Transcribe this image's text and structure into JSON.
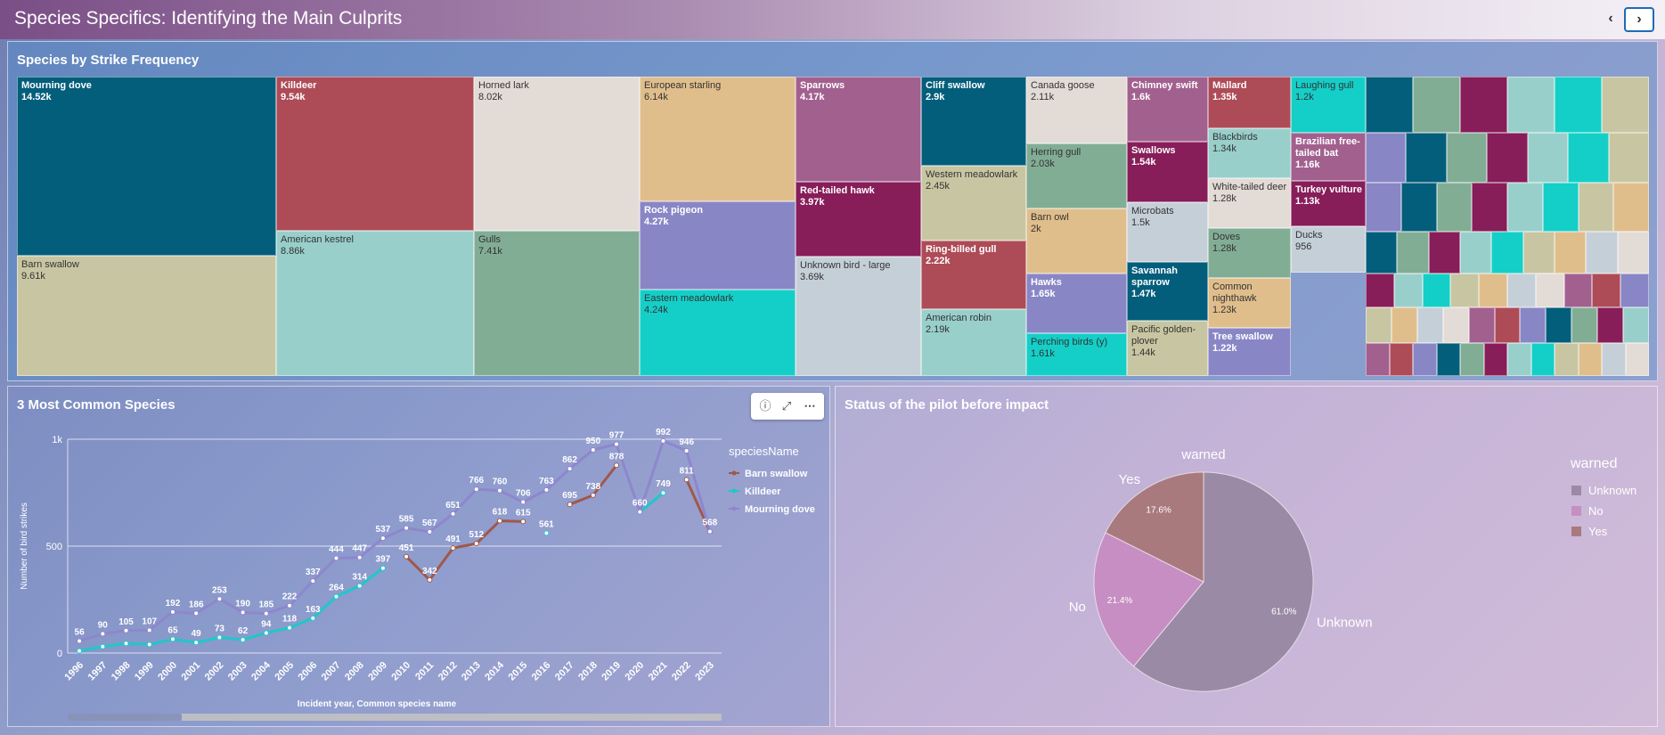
{
  "page": {
    "title": "Species Specifics: Identifying the Main Culprits",
    "prev_label": "‹",
    "next_label": "›"
  },
  "treemap": {
    "title": "Species by Strike Frequency",
    "tiles": [
      {
        "name": "Mourning dove",
        "value": "14.52k",
        "color": "#035e7b",
        "light": true
      },
      {
        "name": "Barn swallow",
        "value": "9.61k",
        "color": "#c8c6a2",
        "light": false
      },
      {
        "name": "Killdeer",
        "value": "9.54k",
        "color": "#ad4b57",
        "light": true
      },
      {
        "name": "American kestrel",
        "value": "8.86k",
        "color": "#99cfcb",
        "light": false
      },
      {
        "name": "Horned lark",
        "value": "8.02k",
        "color": "#e3dbd6",
        "light": false
      },
      {
        "name": "Gulls",
        "value": "7.41k",
        "color": "#82ad95",
        "light": false
      },
      {
        "name": "European starling",
        "value": "6.14k",
        "color": "#e0be8c",
        "light": false
      },
      {
        "name": "Rock pigeon",
        "value": "4.27k",
        "color": "#8986c6",
        "light": true
      },
      {
        "name": "Eastern meadowlark",
        "value": "4.24k",
        "color": "#14cfc8",
        "light": false
      },
      {
        "name": "Sparrows",
        "value": "4.17k",
        "color": "#a2608f",
        "light": true
      },
      {
        "name": "Red-tailed hawk",
        "value": "3.97k",
        "color": "#871d59",
        "light": true
      },
      {
        "name": "Unknown bird - large",
        "value": "3.69k",
        "color": "#c5cfd8",
        "light": false
      },
      {
        "name": "Cliff swallow",
        "value": "2.9k",
        "color": "#035e7b",
        "light": true
      },
      {
        "name": "Western meadowlark",
        "value": "2.45k",
        "color": "#c8c6a2",
        "light": false
      },
      {
        "name": "Ring-billed gull",
        "value": "2.22k",
        "color": "#ad4b57",
        "light": true
      },
      {
        "name": "American robin",
        "value": "2.19k",
        "color": "#99cfcb",
        "light": false
      },
      {
        "name": "Canada goose",
        "value": "2.11k",
        "color": "#e3dbd6",
        "light": false
      },
      {
        "name": "Herring gull",
        "value": "2.03k",
        "color": "#82ad95",
        "light": false
      },
      {
        "name": "Barn owl",
        "value": "2k",
        "color": "#e0be8c",
        "light": false
      },
      {
        "name": "Hawks",
        "value": "1.65k",
        "color": "#8986c6",
        "light": true
      },
      {
        "name": "Perching birds (y)",
        "value": "1.61k",
        "color": "#14cfc8",
        "light": false
      },
      {
        "name": "Chimney swift",
        "value": "1.6k",
        "color": "#a2608f",
        "light": true
      },
      {
        "name": "Swallows",
        "value": "1.54k",
        "color": "#871d59",
        "light": true
      },
      {
        "name": "Microbats",
        "value": "1.5k",
        "color": "#c5cfd8",
        "light": false
      },
      {
        "name": "Savannah sparrow",
        "value": "1.47k",
        "color": "#035e7b",
        "light": true
      },
      {
        "name": "Pacific golden-plover",
        "value": "1.44k",
        "color": "#c8c6a2",
        "light": false
      },
      {
        "name": "Mallard",
        "value": "1.35k",
        "color": "#ad4b57",
        "light": true
      },
      {
        "name": "Blackbirds",
        "value": "1.34k",
        "color": "#99cfcb",
        "light": false
      },
      {
        "name": "White-tailed deer",
        "value": "1.28k",
        "color": "#e3dbd6",
        "light": false
      },
      {
        "name": "Doves",
        "value": "1.28k",
        "color": "#82ad95",
        "light": false
      },
      {
        "name": "Common nighthawk",
        "value": "1.23k",
        "color": "#e0be8c",
        "light": false
      },
      {
        "name": "Tree swallow",
        "value": "1.22k",
        "color": "#8986c6",
        "light": true
      },
      {
        "name": "Laughing gull",
        "value": "1.2k",
        "color": "#14cfc8",
        "light": false
      },
      {
        "name": "Brazilian free-tailed bat",
        "value": "1.16k",
        "color": "#a2608f",
        "light": true
      },
      {
        "name": "Turkey vulture",
        "value": "1.13k",
        "color": "#871d59",
        "light": true
      },
      {
        "name": "Ducks",
        "value": "956",
        "color": "#c5cfd8",
        "light": false
      }
    ],
    "palette": [
      "#035e7b",
      "#c8c6a2",
      "#ad4b57",
      "#99cfcb",
      "#e3dbd6",
      "#82ad95",
      "#e0be8c",
      "#8986c6",
      "#14cfc8",
      "#a2608f",
      "#871d59",
      "#c5cfd8"
    ]
  },
  "line_chart": {
    "title": "3 Most Common Species",
    "info_icon": "info-icon",
    "expand_icon": "expand-icon",
    "more_icon": "more-icon"
  },
  "pie_chart": {
    "title": "Status of the pilot before impact"
  },
  "chart_data": [
    {
      "type": "line",
      "title": "3 Most Common Species",
      "xlabel": "Incident year, Common species name",
      "ylabel": "Number of bird strikes",
      "ylim": [
        0,
        1000
      ],
      "y_ticks": [
        "0",
        "500",
        "1k"
      ],
      "grid": true,
      "legend_title": "speciesName",
      "legend_position": "right",
      "x": [
        "1996",
        "1997",
        "1998",
        "1999",
        "2000",
        "2001",
        "2002",
        "2003",
        "2004",
        "2005",
        "2006",
        "2007",
        "2008",
        "2009",
        "2010",
        "2011",
        "2012",
        "2013",
        "2014",
        "2015",
        "2016",
        "2017",
        "2018",
        "2019",
        "2020",
        "2021",
        "2022",
        "2023"
      ],
      "series": [
        {
          "name": "Barn swallow",
          "color": "#a0584a",
          "values": [
            null,
            null,
            null,
            null,
            null,
            null,
            null,
            null,
            null,
            null,
            null,
            null,
            null,
            null,
            451,
            342,
            491,
            512,
            618,
            615,
            null,
            695,
            738,
            878,
            null,
            null,
            811,
            568
          ]
        },
        {
          "name": "Killdeer",
          "color": "#1fc8c8",
          "values": [
            10,
            30,
            45,
            40,
            65,
            49,
            73,
            62,
            94,
            118,
            163,
            264,
            314,
            397,
            null,
            null,
            null,
            null,
            null,
            null,
            561,
            null,
            null,
            null,
            660,
            749,
            null,
            null
          ]
        },
        {
          "name": "Mourning dove",
          "color": "#8f86cc",
          "values": [
            56,
            90,
            105,
            107,
            192,
            186,
            253,
            190,
            185,
            222,
            337,
            444,
            447,
            537,
            585,
            567,
            651,
            766,
            760,
            706,
            763,
            862,
            950,
            977,
            660,
            992,
            946,
            568
          ]
        }
      ],
      "value_labels": [
        {
          "i": 0,
          "v": 56
        },
        {
          "i": 1,
          "v": 90
        },
        {
          "i": 2,
          "v": 105
        },
        {
          "i": 3,
          "v": 107
        },
        {
          "i": 4,
          "v": 192
        },
        {
          "i": 4,
          "v": 65
        },
        {
          "i": 5,
          "v": 186
        },
        {
          "i": 5,
          "v": 49
        },
        {
          "i": 6,
          "v": 253
        },
        {
          "i": 6,
          "v": 73
        },
        {
          "i": 7,
          "v": 190
        },
        {
          "i": 7,
          "v": 62
        },
        {
          "i": 8,
          "v": 185
        },
        {
          "i": 8,
          "v": 94
        },
        {
          "i": 9,
          "v": 222
        },
        {
          "i": 9,
          "v": 118
        },
        {
          "i": 10,
          "v": 337
        },
        {
          "i": 10,
          "v": 163
        },
        {
          "i": 11,
          "v": 444
        },
        {
          "i": 11,
          "v": 264
        },
        {
          "i": 12,
          "v": 447
        },
        {
          "i": 12,
          "v": 314
        },
        {
          "i": 13,
          "v": 537
        },
        {
          "i": 13,
          "v": 397
        },
        {
          "i": 14,
          "v": 585
        },
        {
          "i": 14,
          "v": 451
        },
        {
          "i": 15,
          "v": 567
        },
        {
          "i": 15,
          "v": 342
        },
        {
          "i": 16,
          "v": 651
        },
        {
          "i": 16,
          "v": 491
        },
        {
          "i": 17,
          "v": 766
        },
        {
          "i": 17,
          "v": 512
        },
        {
          "i": 18,
          "v": 760
        },
        {
          "i": 18,
          "v": 618
        },
        {
          "i": 19,
          "v": 706
        },
        {
          "i": 19,
          "v": 615
        },
        {
          "i": 20,
          "v": 763
        },
        {
          "i": 20,
          "v": 561
        },
        {
          "i": 21,
          "v": 862
        },
        {
          "i": 21,
          "v": 695
        },
        {
          "i": 22,
          "v": 950
        },
        {
          "i": 22,
          "v": 738
        },
        {
          "i": 23,
          "v": 977
        },
        {
          "i": 23,
          "v": 878
        },
        {
          "i": 24,
          "v": 660
        },
        {
          "i": 25,
          "v": 992
        },
        {
          "i": 25,
          "v": 749
        },
        {
          "i": 26,
          "v": 946
        },
        {
          "i": 26,
          "v": 811
        },
        {
          "i": 27,
          "v": 568
        }
      ]
    },
    {
      "type": "pie",
      "title": "warned",
      "legend_title": "warned",
      "legend_position": "right",
      "slices": [
        {
          "label": "Unknown",
          "value": 61.0,
          "pct": "61.0%",
          "color": "#9b8aa6"
        },
        {
          "label": "No",
          "value": 21.4,
          "pct": "21.4%",
          "color": "#c68ec2"
        },
        {
          "label": "Yes",
          "value": 17.6,
          "pct": "17.6%",
          "color": "#a97a7d"
        }
      ]
    }
  ]
}
